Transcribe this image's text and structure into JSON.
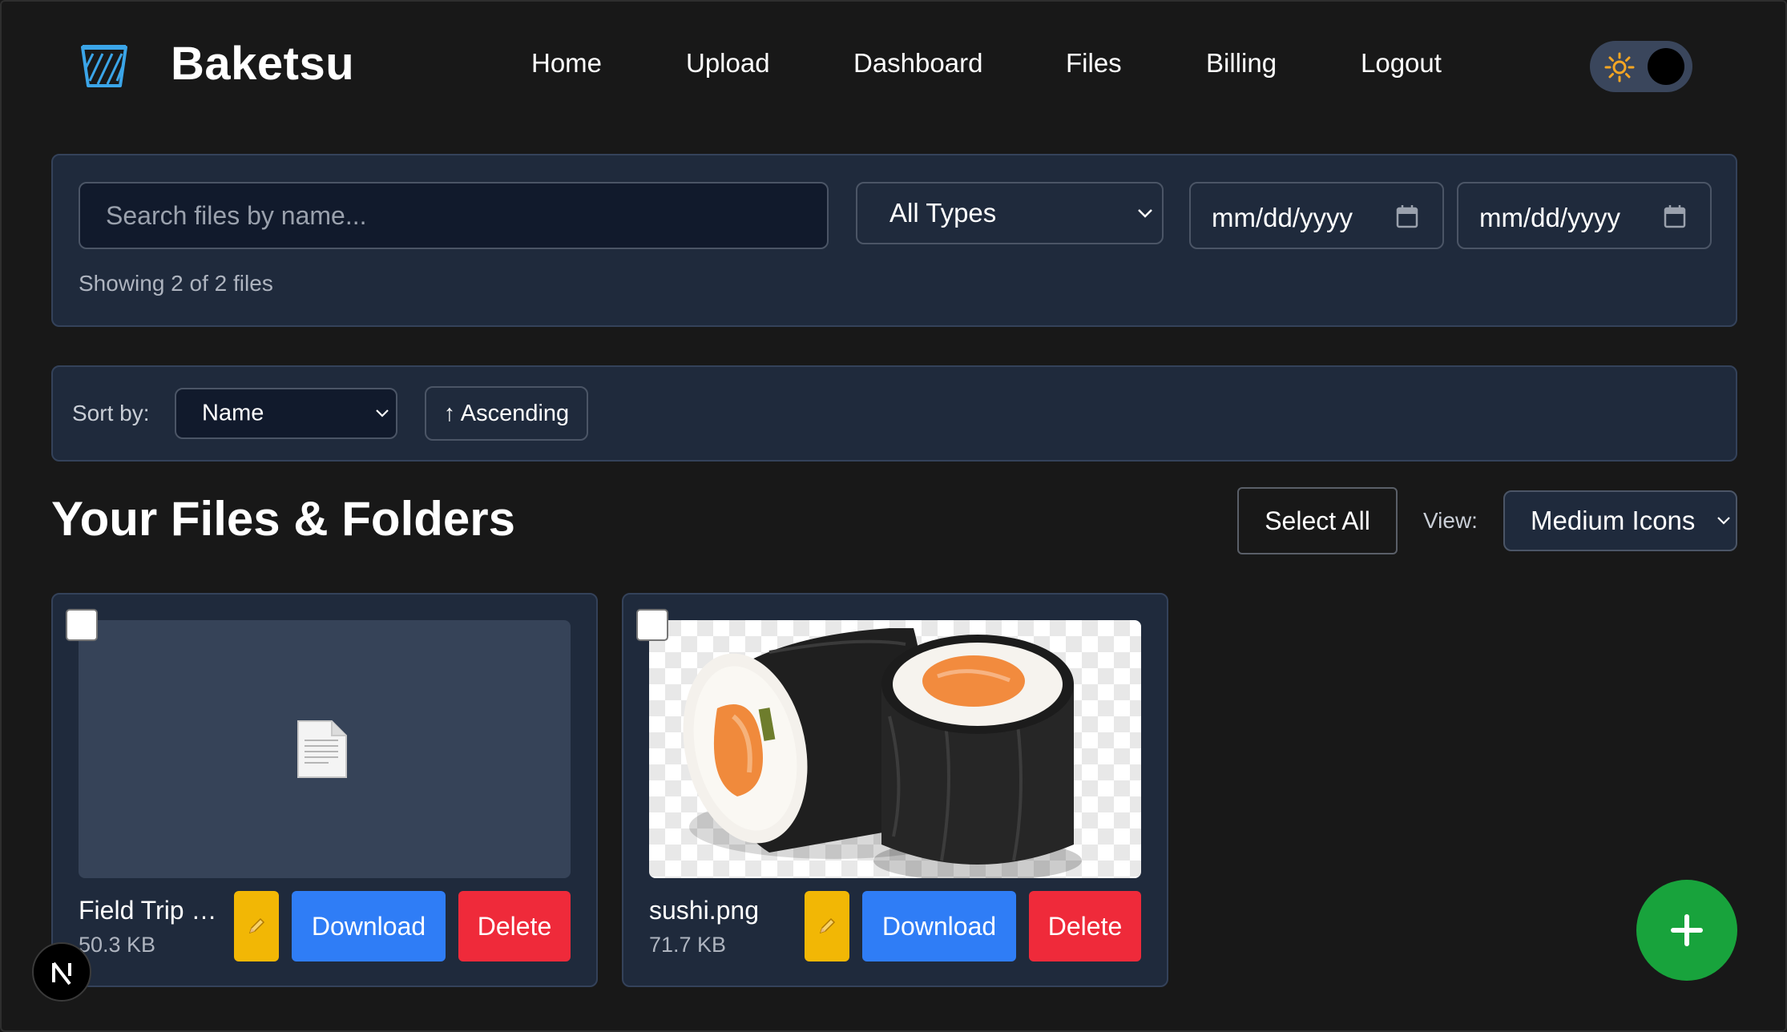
{
  "app": {
    "brand": "Baketsu",
    "logo_icon": "bucket-logo-icon"
  },
  "nav": {
    "items": [
      {
        "label": "Home"
      },
      {
        "label": "Upload"
      },
      {
        "label": "Dashboard"
      },
      {
        "label": "Files"
      },
      {
        "label": "Billing"
      },
      {
        "label": "Logout"
      }
    ]
  },
  "theme_toggle": {
    "icon": "sun-icon",
    "state": "dark"
  },
  "filters": {
    "search_placeholder": "Search files by name...",
    "type_selected": "All Types",
    "date_from": "mm/dd/yyyy",
    "date_to": "mm/dd/yyyy",
    "showing_text": "Showing 2 of 2 files"
  },
  "sort": {
    "label": "Sort by:",
    "selected": "Name",
    "order_label": "↑ Ascending"
  },
  "files_section": {
    "title": "Your Files & Folders",
    "select_all_label": "Select All",
    "view_label": "View:",
    "view_selected": "Medium Icons"
  },
  "files": [
    {
      "name": "Field Trip …",
      "size": "50.3 KB",
      "preview": "document-icon",
      "download_label": "Download",
      "delete_label": "Delete",
      "rename_icon": "pencil-icon"
    },
    {
      "name": "sushi.png",
      "size": "71.7 KB",
      "preview": "sushi-image",
      "download_label": "Download",
      "delete_label": "Delete",
      "rename_icon": "pencil-icon"
    }
  ],
  "colors": {
    "background": "#181818",
    "panel": "#1f2a3c",
    "download": "#2f7df6",
    "delete": "#ef2a3a",
    "rename": "#f2b705",
    "fab": "#18a33c",
    "logo": "#3ba5e8"
  },
  "fab": {
    "icon": "plus-icon"
  },
  "dev_badge": {
    "icon": "next-logo-icon"
  }
}
